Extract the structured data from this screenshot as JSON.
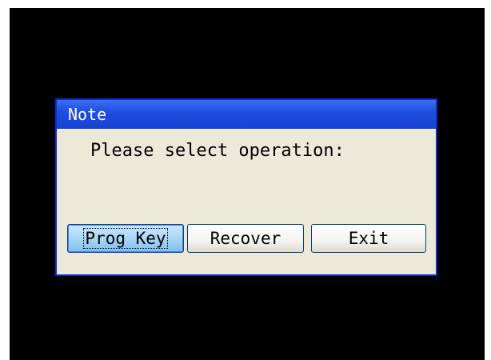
{
  "dialog": {
    "title": "Note",
    "prompt": "Please select operation:",
    "buttons": [
      {
        "label": "Prog Key",
        "focused": true
      },
      {
        "label": "Recover",
        "focused": false
      },
      {
        "label": "Exit",
        "focused": false
      }
    ]
  },
  "colors": {
    "screen_background": "#000000",
    "titlebar": "#1E4FE0",
    "dialog_body": "#ECE9D8",
    "focused_button": "#A9D6F7"
  }
}
